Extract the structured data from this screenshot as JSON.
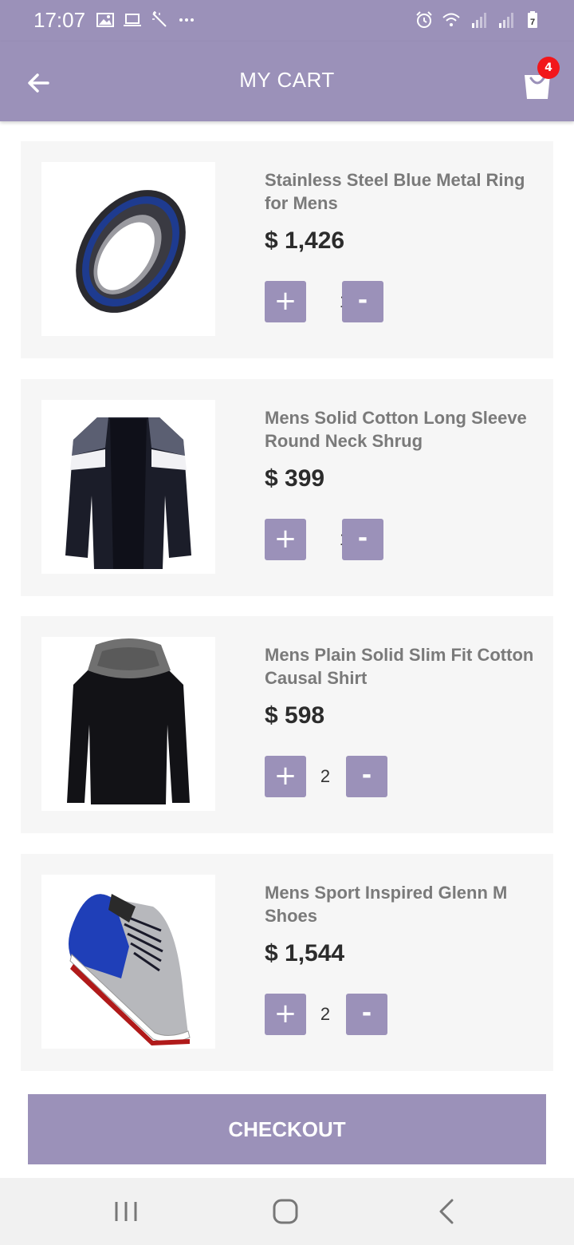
{
  "status_bar": {
    "time": "17:07",
    "left_icons": [
      "image-icon",
      "laptop-icon",
      "magic-wand-icon",
      "more-dots-icon"
    ],
    "right_icons": [
      "alarm-icon",
      "wifi-icon",
      "signal-icon",
      "signal-icon",
      "battery-icon"
    ],
    "battery_level": "7"
  },
  "header": {
    "title": "MY CART",
    "back_icon": "arrow-left-icon",
    "cart_icon": "shopping-bag-icon",
    "cart_count": "4"
  },
  "colors": {
    "accent": "#9b91b9",
    "badge": "#f2161b",
    "card_background": "#f6f6f6"
  },
  "items": [
    {
      "name": "Stainless Steel Blue Metal Ring for Mens",
      "price": "$ 1,426",
      "quantity": "1",
      "image": "ring-image"
    },
    {
      "name": "Mens Solid Cotton Long Sleeve Round Neck Shrug",
      "price": "$ 399",
      "quantity": "1",
      "image": "shrug-image"
    },
    {
      "name": "Mens Plain Solid Slim Fit Cotton Causal Shirt",
      "price": "$ 598",
      "quantity": "2",
      "image": "shirt-image"
    },
    {
      "name": "Mens Sport Inspired Glenn M Shoes",
      "price": "$ 1,544",
      "quantity": "2",
      "image": "shoe-image"
    }
  ],
  "qty_controls": {
    "plus": "+",
    "minus": "-"
  },
  "checkout": {
    "label": "CHECKOUT"
  },
  "nav_bar": {
    "items": [
      "recent-apps-icon",
      "home-icon",
      "back-icon"
    ]
  }
}
